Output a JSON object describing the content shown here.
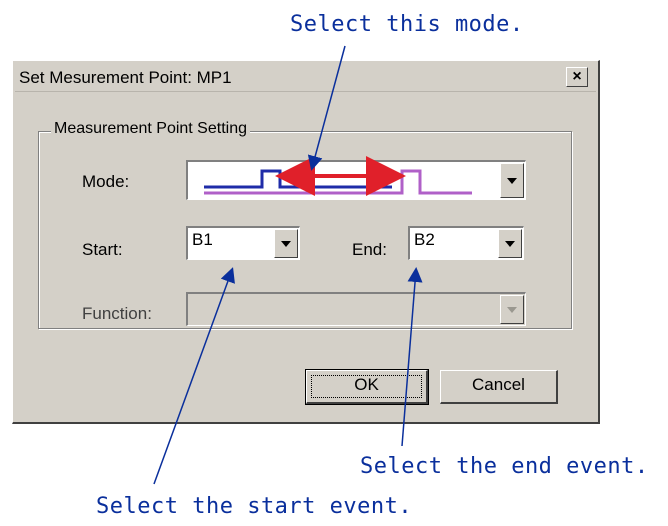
{
  "annotations": {
    "mode": "Select this mode.",
    "end": "Select the end event.",
    "start": "Select the start event."
  },
  "dialog": {
    "title": "Set Mesurement Point: MP1",
    "close_glyph": "×",
    "group_label": "Measurement Point Setting",
    "mode_label": "Mode:",
    "start_label": "Start:",
    "start_value": "B1",
    "end_label": "End:",
    "end_value": "B2",
    "function_label": "Function:",
    "function_value": "",
    "ok_label": "OK",
    "cancel_label": "Cancel"
  },
  "colors": {
    "annotation": "#0a2f9c",
    "mode_arrow": "#e0202a",
    "signal_blue": "#1f2ca8",
    "signal_purple": "#b060c8",
    "dialog_bg": "#d4d0c8"
  },
  "icons": {
    "mode_icon": "start-end-interval-icon",
    "dropdown": "chevron-down-icon"
  }
}
